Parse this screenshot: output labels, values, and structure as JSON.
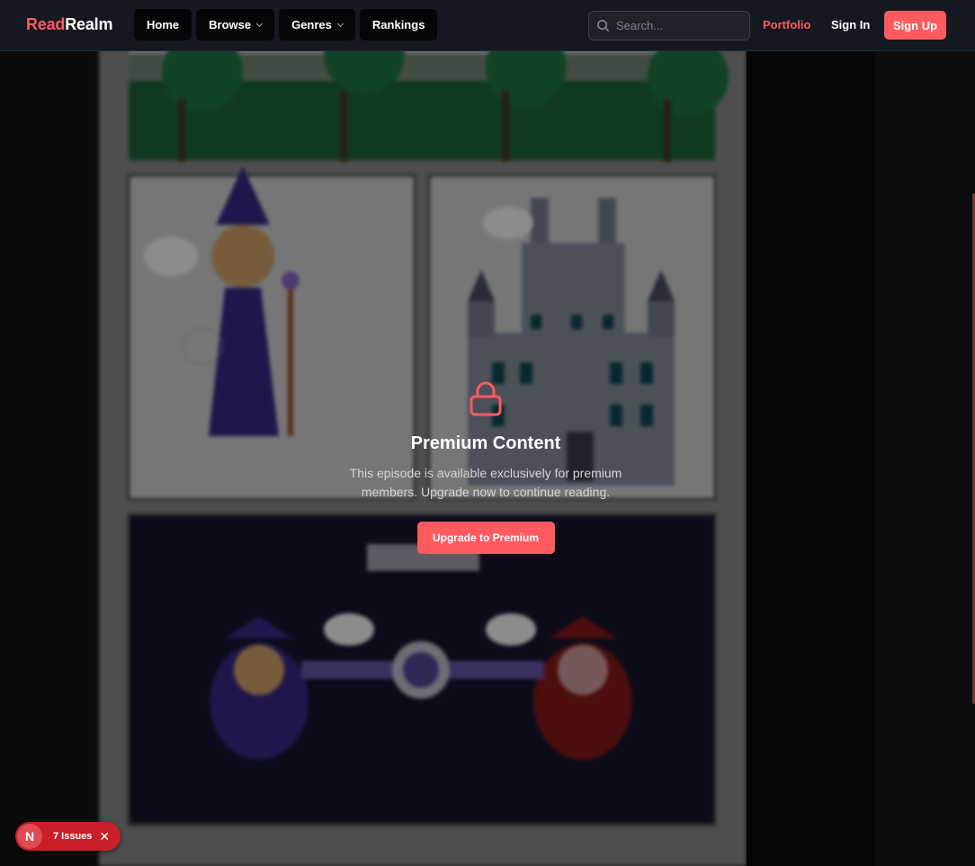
{
  "brand": {
    "part1": "Read",
    "part2": "Realm"
  },
  "nav": {
    "items": [
      {
        "label": "Home",
        "has_dropdown": false
      },
      {
        "label": "Browse",
        "has_dropdown": true
      },
      {
        "label": "Genres",
        "has_dropdown": true
      },
      {
        "label": "Rankings",
        "has_dropdown": false
      }
    ],
    "search_placeholder": "Search...",
    "portfolio": "Portfolio",
    "sign_in": "Sign In",
    "sign_up": "Sign Up"
  },
  "premium": {
    "icon": "lock-icon",
    "title": "Premium Content",
    "message": "This episode is available exclusively for premium members. Upgrade now to continue reading.",
    "cta": "Upgrade to Premium"
  },
  "issues_badge": {
    "letter": "N",
    "label": "7 Issues",
    "close": "✕"
  },
  "colors": {
    "accent": "#ff5a5f",
    "navbar_bg": "#141820",
    "page_bg": "#121212",
    "badge_bg": "#c91f28"
  }
}
